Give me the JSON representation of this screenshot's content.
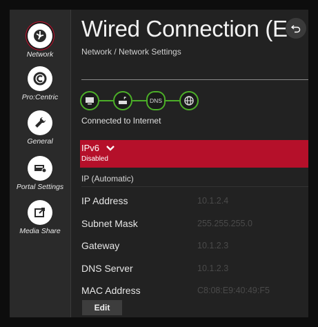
{
  "sidebar": {
    "items": [
      {
        "label": "Network",
        "icon": "network-icon"
      },
      {
        "label": "Pro:Centric",
        "icon": "procentric-icon"
      },
      {
        "label": "General",
        "icon": "wrench-icon"
      },
      {
        "label": "Portal Settings",
        "icon": "portal-icon"
      },
      {
        "label": "Media Share",
        "icon": "media-share-icon"
      }
    ]
  },
  "header": {
    "title": "Wired Connection (E",
    "breadcrumb": "Network / Network Settings"
  },
  "connection": {
    "nodes": [
      "tv-icon",
      "router-icon",
      "DNS",
      "globe-icon"
    ],
    "status": "Connected to Internet"
  },
  "ipv6": {
    "label": "IPv6",
    "value": "Disabled"
  },
  "ip_section": {
    "label": "IP (Automatic)",
    "rows": [
      {
        "key": "IP Address",
        "value": "10.1.2.4"
      },
      {
        "key": "Subnet Mask",
        "value": "255.255.255.0"
      },
      {
        "key": "Gateway",
        "value": "10.1.2.3"
      },
      {
        "key": "DNS Server",
        "value": "10.1.2.3"
      },
      {
        "key": "MAC Address",
        "value": "C8:08:E9:40:49:F5"
      }
    ]
  },
  "actions": {
    "edit_label": "Edit"
  },
  "colors": {
    "accent_red": "#b5102a",
    "connected_green": "#4caf28"
  }
}
